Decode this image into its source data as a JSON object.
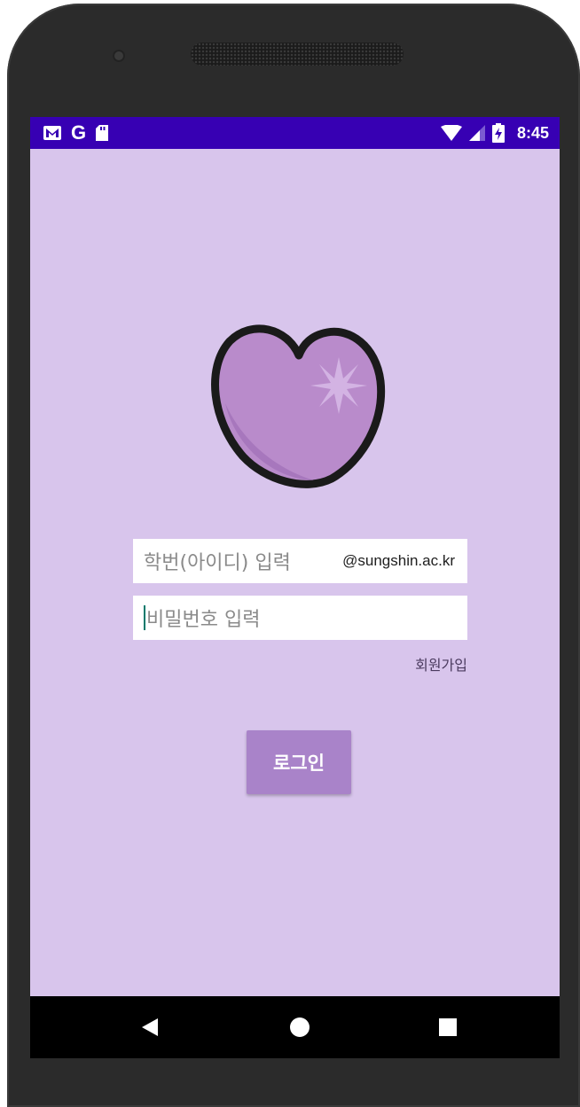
{
  "status_bar": {
    "time": "8:45",
    "left_icons": [
      "gmail-icon",
      "google-icon",
      "sd-card-icon"
    ],
    "google_letter": "G",
    "right_icons": [
      "wifi-icon",
      "signal-icon",
      "battery-charging-icon"
    ],
    "color": "#3700b3"
  },
  "app": {
    "background": "#d8c5ec",
    "logo_icon": "heart-logo-icon"
  },
  "login_form": {
    "id_placeholder": "학번(아이디) 입력",
    "email_domain": "@sungshin.ac.kr",
    "password_placeholder": "비밀번호 입력",
    "signup_label": "회원가입",
    "login_label": "로그인",
    "button_color": "#a983c9"
  },
  "nav_bar": {
    "icons": [
      "back-icon",
      "home-icon",
      "recent-apps-icon"
    ]
  }
}
